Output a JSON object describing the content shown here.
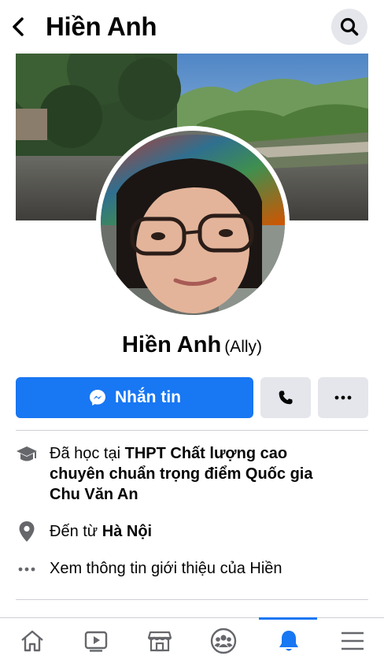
{
  "header": {
    "title": "Hiền Anh",
    "back_icon": "chevron-left-icon",
    "search_icon": "search-icon"
  },
  "profile": {
    "name": "Hiền Anh",
    "alternate_name": "(Ally)"
  },
  "actions": {
    "message_label": "Nhắn tin",
    "message_icon": "messenger-icon",
    "call_icon": "phone-icon",
    "more_icon": "more-horizontal-icon"
  },
  "intro": {
    "education": {
      "prefix": "Đã học tại ",
      "school_line1": "THPT Chất lượng cao",
      "school_line2": "chuyên chuẩn trọng điểm Quốc gia",
      "school_line3": "Chu Văn An",
      "icon": "graduation-cap-icon"
    },
    "hometown": {
      "prefix": "Đến từ ",
      "place": "Hà Nội",
      "icon": "location-pin-icon"
    },
    "see_more": {
      "label": "Xem thông tin giới thiệu của Hiền",
      "icon": "more-horizontal-icon"
    }
  },
  "tabbar": {
    "items": [
      {
        "icon": "home-icon",
        "active": false
      },
      {
        "icon": "video-play-icon",
        "active": false
      },
      {
        "icon": "marketplace-store-icon",
        "active": false
      },
      {
        "icon": "groups-icon",
        "active": false
      },
      {
        "icon": "notifications-bell-icon",
        "active": true
      },
      {
        "icon": "menu-hamburger-icon",
        "active": false
      }
    ]
  },
  "colors": {
    "accent": "#1877f2",
    "button_gray": "#e4e6eb",
    "icon_gray": "#65676b",
    "text": "#050505"
  }
}
